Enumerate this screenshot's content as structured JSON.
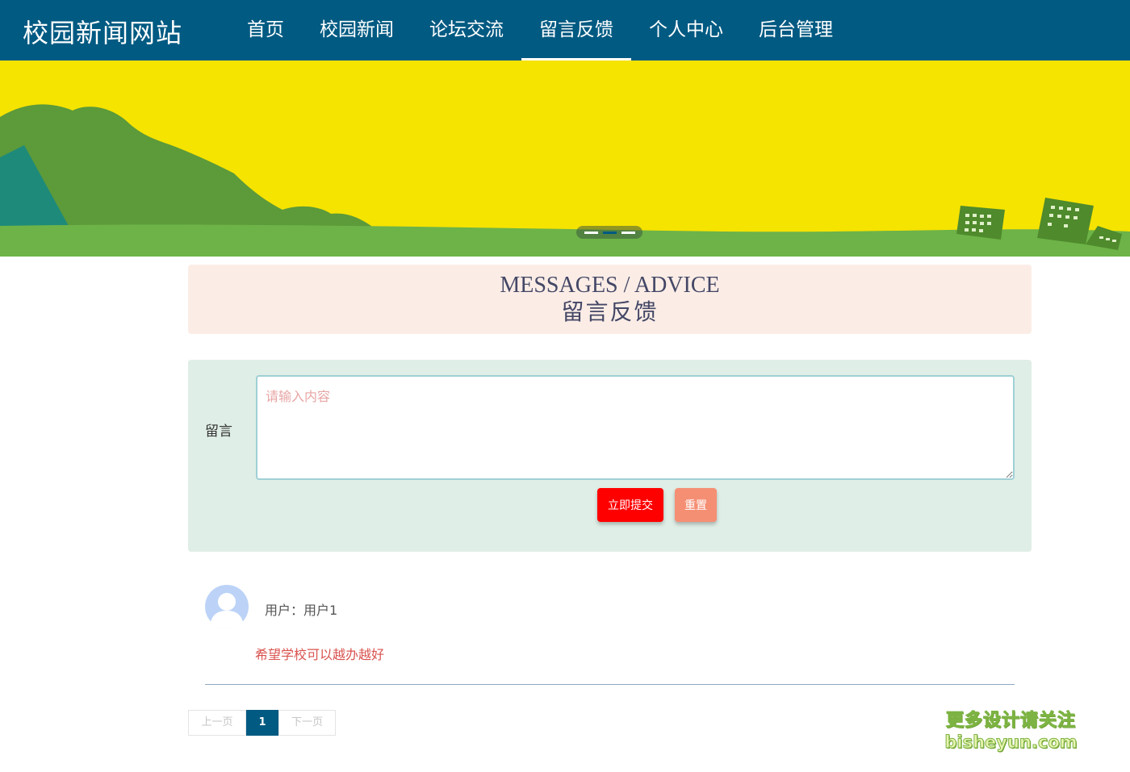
{
  "header": {
    "logo": "校园新闻网站",
    "nav": [
      {
        "label": "首页"
      },
      {
        "label": "校园新闻"
      },
      {
        "label": "论坛交流"
      },
      {
        "label": "留言反馈",
        "active": true
      },
      {
        "label": "个人中心"
      },
      {
        "label": "后台管理"
      }
    ]
  },
  "banner": {
    "dots": 3,
    "active_dot": 2,
    "colors": {
      "sky": "#f5e300",
      "hill": "#6aa84f",
      "ground": "#6db348",
      "teal": "#1e8a7a"
    }
  },
  "section": {
    "title_en": "MESSAGES / ADVICE",
    "title_cn": "留言反馈"
  },
  "form": {
    "label": "留言",
    "placeholder": "请输入内容",
    "value": "",
    "submit_label": "立即提交",
    "reset_label": "重置"
  },
  "messages": [
    {
      "user": "用户：用户1",
      "content": "希望学校可以越办越好"
    }
  ],
  "pagination": {
    "prev_label": "上一页",
    "current": "1",
    "next_label": "下一页"
  },
  "watermark": {
    "line1": "更多设计请关注",
    "line2": "bisheyun.com"
  },
  "colors": {
    "header_bg": "#005a82",
    "title_bg": "#fbede6",
    "form_bg": "#dfeee6",
    "submit_bg": "#ff0000",
    "reset_bg": "#f58f74"
  }
}
